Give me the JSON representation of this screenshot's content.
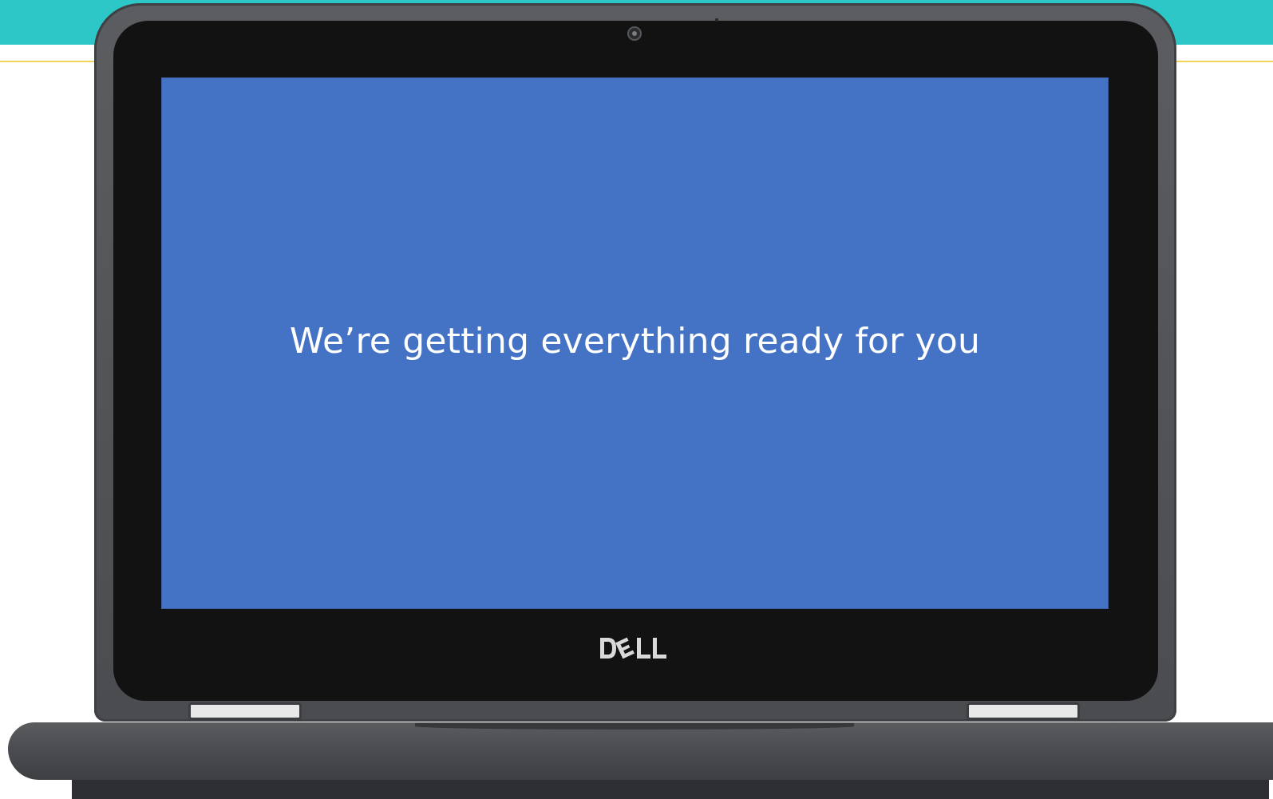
{
  "screen": {
    "message": "We’re getting everything ready for you",
    "background_color": "#4472c4",
    "text_color": "#ffffff"
  },
  "device": {
    "brand": "DELL",
    "bezel_color": "#121212",
    "shell_color": "#4b4d51"
  },
  "background": {
    "banner_color": "#2ec7c7",
    "accent_line_color": "#f3d45a"
  },
  "icons": {
    "camera": "webcam-icon",
    "logo": "dell-logo"
  }
}
